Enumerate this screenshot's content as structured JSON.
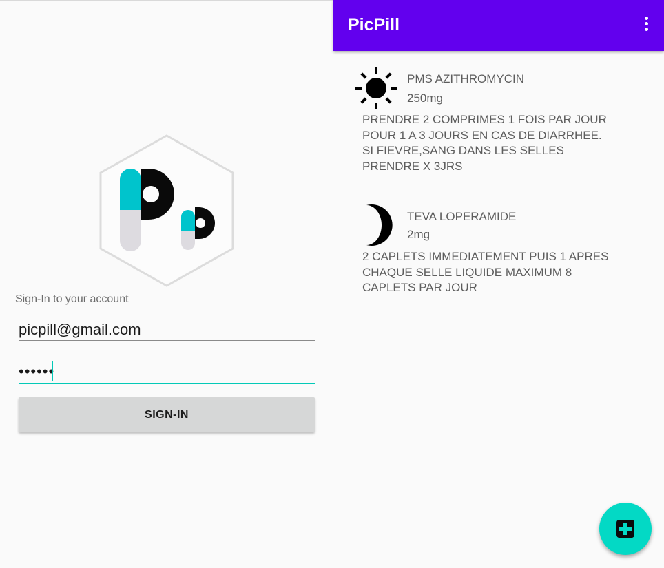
{
  "login": {
    "caption": "Sign-In to your account",
    "email_value": "picpill@gmail.com",
    "password_value": "••••••",
    "signin_label": "SIGN-IN"
  },
  "app_bar": {
    "title": "PicPill",
    "menu_icon": "more-vert-icon"
  },
  "medications": [
    {
      "icon": "sun-icon",
      "name": "PMS AZITHROMYCIN",
      "dose": "250mg",
      "instructions": "PRENDRE 2 COMPRIMES 1 FOIS PAR JOUR\nPOUR 1 A 3 JOURS EN CAS DE DIARRHEE.\nSI FIEVRE,SANG DANS LES SELLES\nPRENDRE X 3JRS"
    },
    {
      "icon": "moon-icon",
      "name": "TEVA LOPERAMIDE",
      "dose": "2mg",
      "instructions": "2 CAPLETS IMMEDIATEMENT PUIS 1 APRES\nCHAQUE SELLE LIQUIDE MAXIMUM 8\nCAPLETS PAR JOUR"
    }
  ],
  "fab": {
    "icon": "medical-plus-icon"
  },
  "colors": {
    "primary": "#6200ee",
    "accent": "#03d9c5",
    "logo_teal": "#00c4cc",
    "logo_gray": "#dddbe0"
  }
}
